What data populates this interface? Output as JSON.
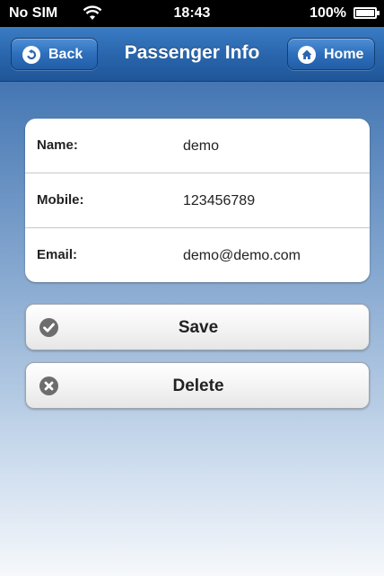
{
  "status_bar": {
    "carrier": "No SIM",
    "time": "18:43",
    "battery": "100%"
  },
  "nav": {
    "title": "Passenger Info",
    "back_label": "Back",
    "home_label": "Home"
  },
  "form": {
    "rows": [
      {
        "label": "Name:",
        "value": "demo"
      },
      {
        "label": "Mobile:",
        "value": "123456789"
      },
      {
        "label": "Email:",
        "value": "demo@demo.com"
      }
    ]
  },
  "actions": {
    "save_label": "Save",
    "delete_label": "Delete"
  },
  "icons": {
    "back": "back-icon",
    "home": "home-icon",
    "save": "check-circle-icon",
    "delete": "x-circle-icon",
    "wifi": "wifi-icon",
    "battery": "battery-icon"
  },
  "colors": {
    "nav_bar": "#2a66ad",
    "background_top": "#2d5f9b",
    "background_bottom": "#f6f8fb",
    "button_icon": "#6d6d6d"
  }
}
